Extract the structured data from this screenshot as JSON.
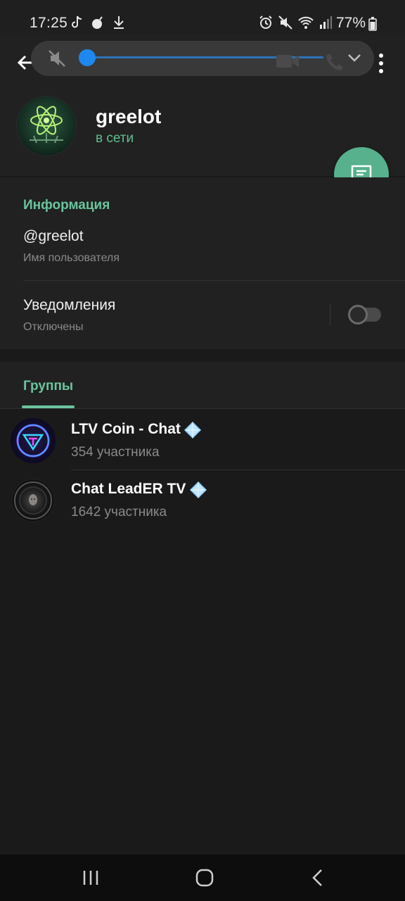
{
  "status_bar": {
    "time": "17:25",
    "battery": "77%",
    "left_icons": [
      "tiktok-icon",
      "bomb-icon",
      "download-icon"
    ],
    "right_icons": [
      "alarm-icon",
      "mute-icon",
      "wifi-icon",
      "signal-icon",
      "battery-icon"
    ]
  },
  "media_panel": {
    "volume_level": 0.04,
    "accent_color": "#1e88f0"
  },
  "profile": {
    "name": "greelot",
    "status": "в сети"
  },
  "info": {
    "section_title": "Информация",
    "username": "@greelot",
    "username_label": "Имя пользователя",
    "notifications_title": "Уведомления",
    "notifications_state": "Отключены",
    "notifications_enabled": false
  },
  "groups": {
    "tab_label": "Группы",
    "items": [
      {
        "title": "LTV Coin - Chat",
        "subtitle": "354 участника",
        "verified_icon": "diamond-icon"
      },
      {
        "title": "Chat LeadER TV",
        "subtitle": "1642 участника",
        "verified_icon": "diamond-icon"
      }
    ]
  },
  "colors": {
    "accent": "#6bc49e",
    "fab": "#56b18c",
    "background": "#1a1a1a"
  }
}
